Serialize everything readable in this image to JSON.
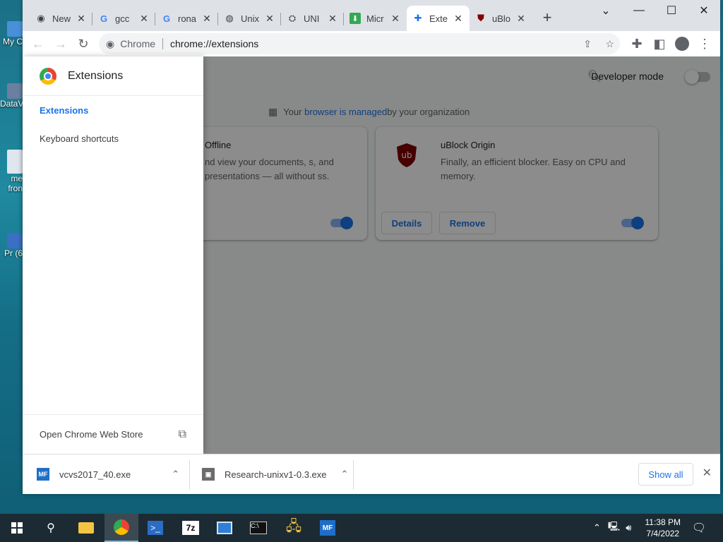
{
  "desktop": {
    "icons": [
      {
        "label": "My C",
        "color": "#4a90d9"
      },
      {
        "label": "DataV",
        "color": "#6b7fa0"
      },
      {
        "label": "me fron",
        "color": "#dfe6ee"
      },
      {
        "label": "Pr (6",
        "color": "#3a6fc4"
      }
    ]
  },
  "browser": {
    "tabs": [
      {
        "title": "New",
        "icon": "chrome-icon"
      },
      {
        "title": "gcc",
        "icon": "google-icon"
      },
      {
        "title": "rona",
        "icon": "google-icon"
      },
      {
        "title": "Unix",
        "icon": "globe-icon"
      },
      {
        "title": "UNI",
        "icon": "unix-icon"
      },
      {
        "title": "Micr",
        "icon": "download-arrow-icon"
      },
      {
        "title": "Exte",
        "icon": "puzzle-icon"
      },
      {
        "title": "uBlo",
        "icon": "ublock-icon"
      }
    ],
    "active_tab": 6,
    "omnibox": {
      "chip": "Chrome",
      "url": "chrome://extensions"
    }
  },
  "extensions_page": {
    "drawer_title": "Extensions",
    "nav": [
      "Extensions",
      "Keyboard shortcuts"
    ],
    "footer_link": "Open Chrome Web Store",
    "developer_mode_label": "Developer mode",
    "managed_notice": {
      "prefix": "Your ",
      "link": "browser is managed",
      "suffix": " by your organization"
    },
    "cards": [
      {
        "name": "Offline",
        "description": "nd view your documents, s, and presentations — all without ss.",
        "enabled": true
      },
      {
        "name": "uBlock Origin",
        "description": "Finally, an efficient blocker. Easy on CPU and memory.",
        "details_label": "Details",
        "remove_label": "Remove",
        "enabled": true
      }
    ]
  },
  "downloads": {
    "items": [
      "vcvs2017_40.exe",
      "Research-unixv1-0.3.exe"
    ],
    "show_all": "Show all"
  },
  "taskbar": {
    "clock_time": "11:38 PM",
    "clock_date": "7/4/2022"
  }
}
